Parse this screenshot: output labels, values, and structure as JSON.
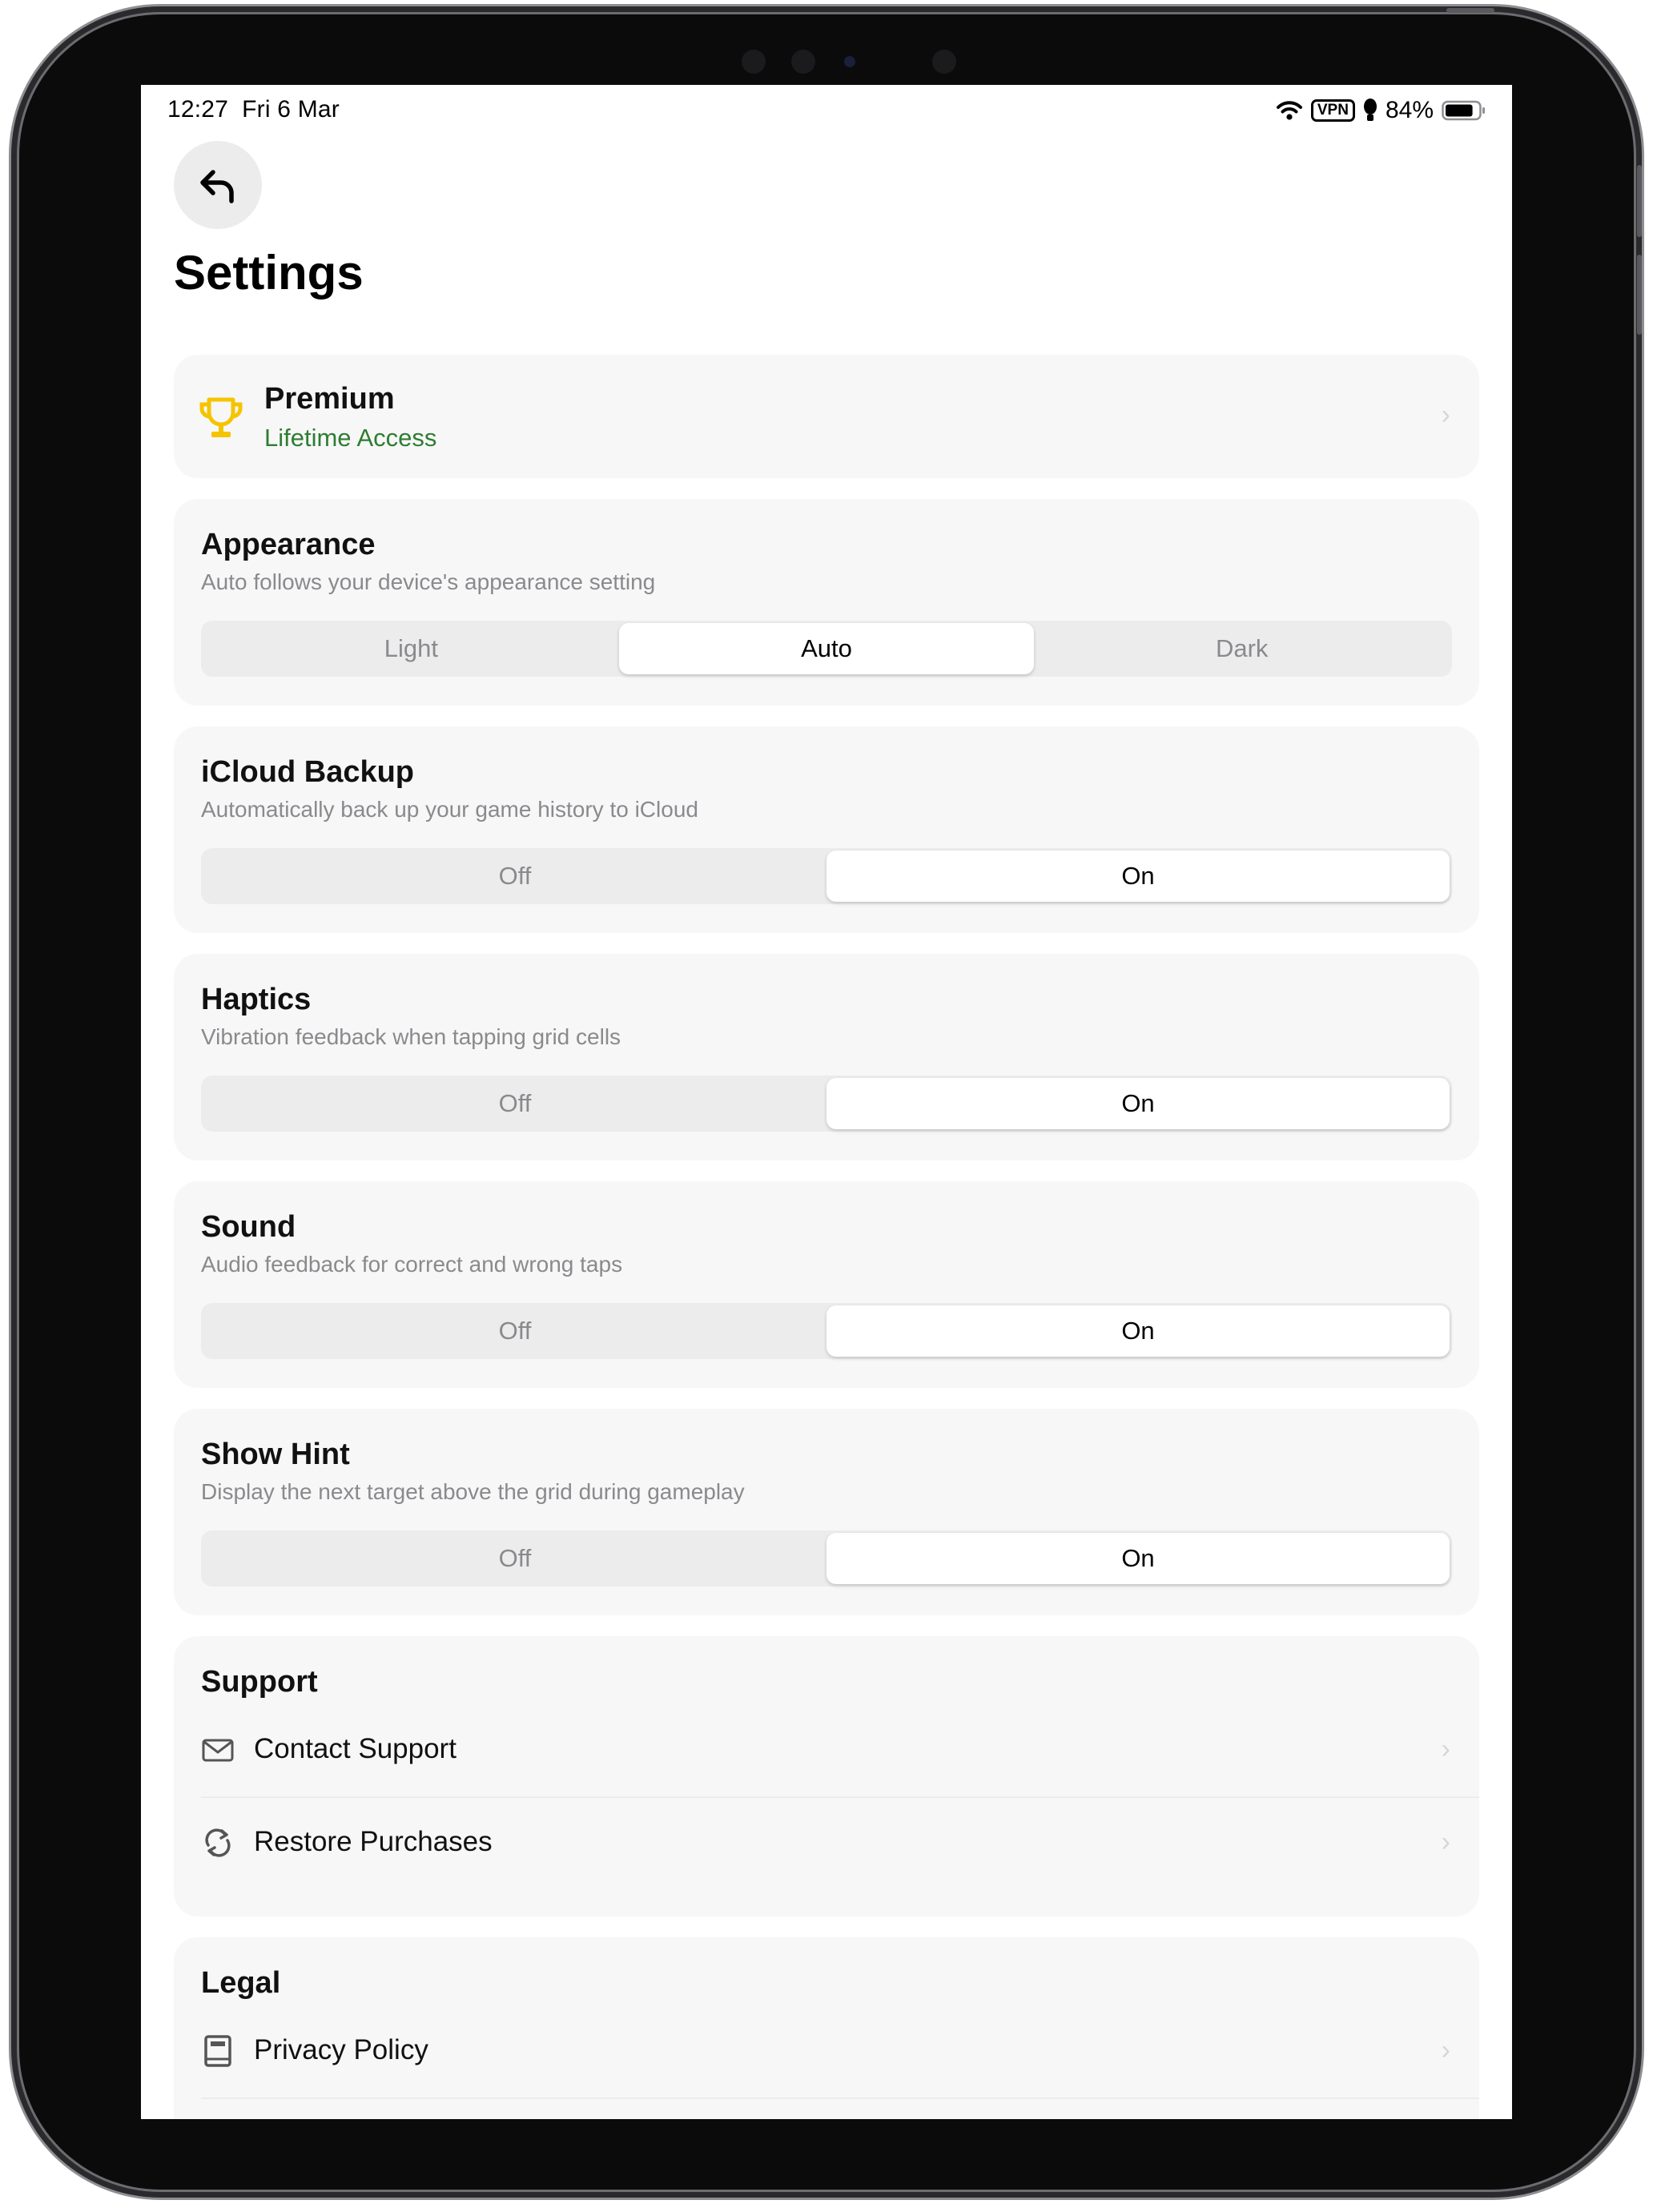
{
  "status_bar": {
    "time": "12:27",
    "date": "Fri 6 Mar",
    "vpn": "VPN",
    "battery_percent": "84%",
    "battery_level": 0.84
  },
  "header": {
    "back_icon": "back-arrow-icon",
    "title": "Settings"
  },
  "premium": {
    "icon": "trophy-icon",
    "title": "Premium",
    "subtitle": "Lifetime Access",
    "subtitle_color": "#2e7d32",
    "icon_color": "#f5c400"
  },
  "appearance": {
    "title": "Appearance",
    "description": "Auto follows your device's appearance setting",
    "options": [
      "Light",
      "Auto",
      "Dark"
    ],
    "selected": "Auto"
  },
  "icloud": {
    "title": "iCloud Backup",
    "description": "Automatically back up your game history to iCloud",
    "off_label": "Off",
    "on_label": "On",
    "selected": "On"
  },
  "haptics": {
    "title": "Haptics",
    "description": "Vibration feedback when tapping grid cells",
    "off_label": "Off",
    "on_label": "On",
    "selected": "On"
  },
  "sound": {
    "title": "Sound",
    "description": "Audio feedback for correct and wrong taps",
    "off_label": "Off",
    "on_label": "On",
    "selected": "On"
  },
  "hint": {
    "title": "Show Hint",
    "description": "Display the next target above the grid during gameplay",
    "off_label": "Off",
    "on_label": "On",
    "selected": "On"
  },
  "support": {
    "title": "Support",
    "items": [
      {
        "label": "Contact Support",
        "icon": "envelope-icon"
      },
      {
        "label": "Restore Purchases",
        "icon": "restore-icon"
      }
    ]
  },
  "legal": {
    "title": "Legal",
    "items": [
      {
        "label": "Privacy Policy",
        "icon": "book-icon"
      }
    ]
  }
}
